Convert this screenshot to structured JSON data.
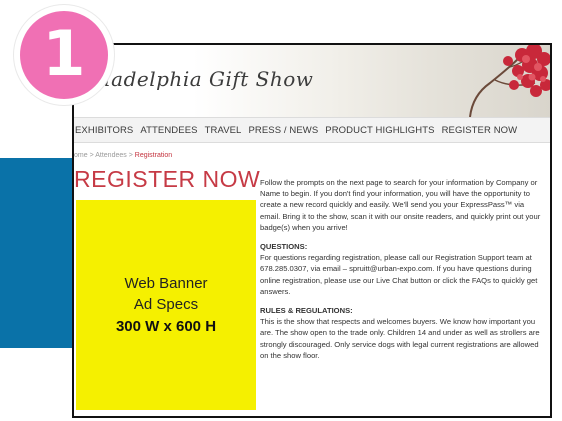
{
  "badge": {
    "number": "1"
  },
  "site": {
    "logo_text": "hiladelphia Gift Show"
  },
  "nav": {
    "items": [
      "EXHIBITORS",
      "ATTENDEES",
      "TRAVEL",
      "PRESS / NEWS",
      "PRODUCT HIGHLIGHTS",
      "REGISTER NOW"
    ]
  },
  "breadcrumb": {
    "home": "ome",
    "sep1": ">",
    "attendees": "Attendees",
    "sep2": ">",
    "current": "Registration"
  },
  "page_title": "REGISTER NOW",
  "ad": {
    "line1": "Web Banner",
    "line2": "Ad Specs",
    "line3": "300 W x 600 H"
  },
  "content": {
    "intro": "Follow the prompts on the next page to search for your information by Company or Name to begin. If you don't find your information, you will have the opportunity to create a new record quickly and easily. We'll send you your ExpressPass™ via email. Bring it to the show, scan it with our onsite readers, and quickly print out your badge(s) when you arrive!",
    "questions_heading": "QUESTIONS:",
    "questions_text": "For questions regarding registration, please call our Registration Support team at 678.285.0307, via email – spruitt@urban-expo.com. If you have questions during online registration, please use our Live Chat button or click the FAQs to quickly get answers.",
    "rules_heading": "RULES & REGULATIONS:",
    "rules_text": "This is the show that respects and welcomes buyers. We know how important you are. The show open to the trade only. Children 14 and under as well as strollers are strongly discouraged. Only service dogs with legal current registrations are allowed on the show floor."
  },
  "colors": {
    "accent_red": "#c63a45",
    "badge_pink": "#f070b4",
    "ad_yellow": "#f5f000",
    "side_blue": "#0a72a8"
  }
}
